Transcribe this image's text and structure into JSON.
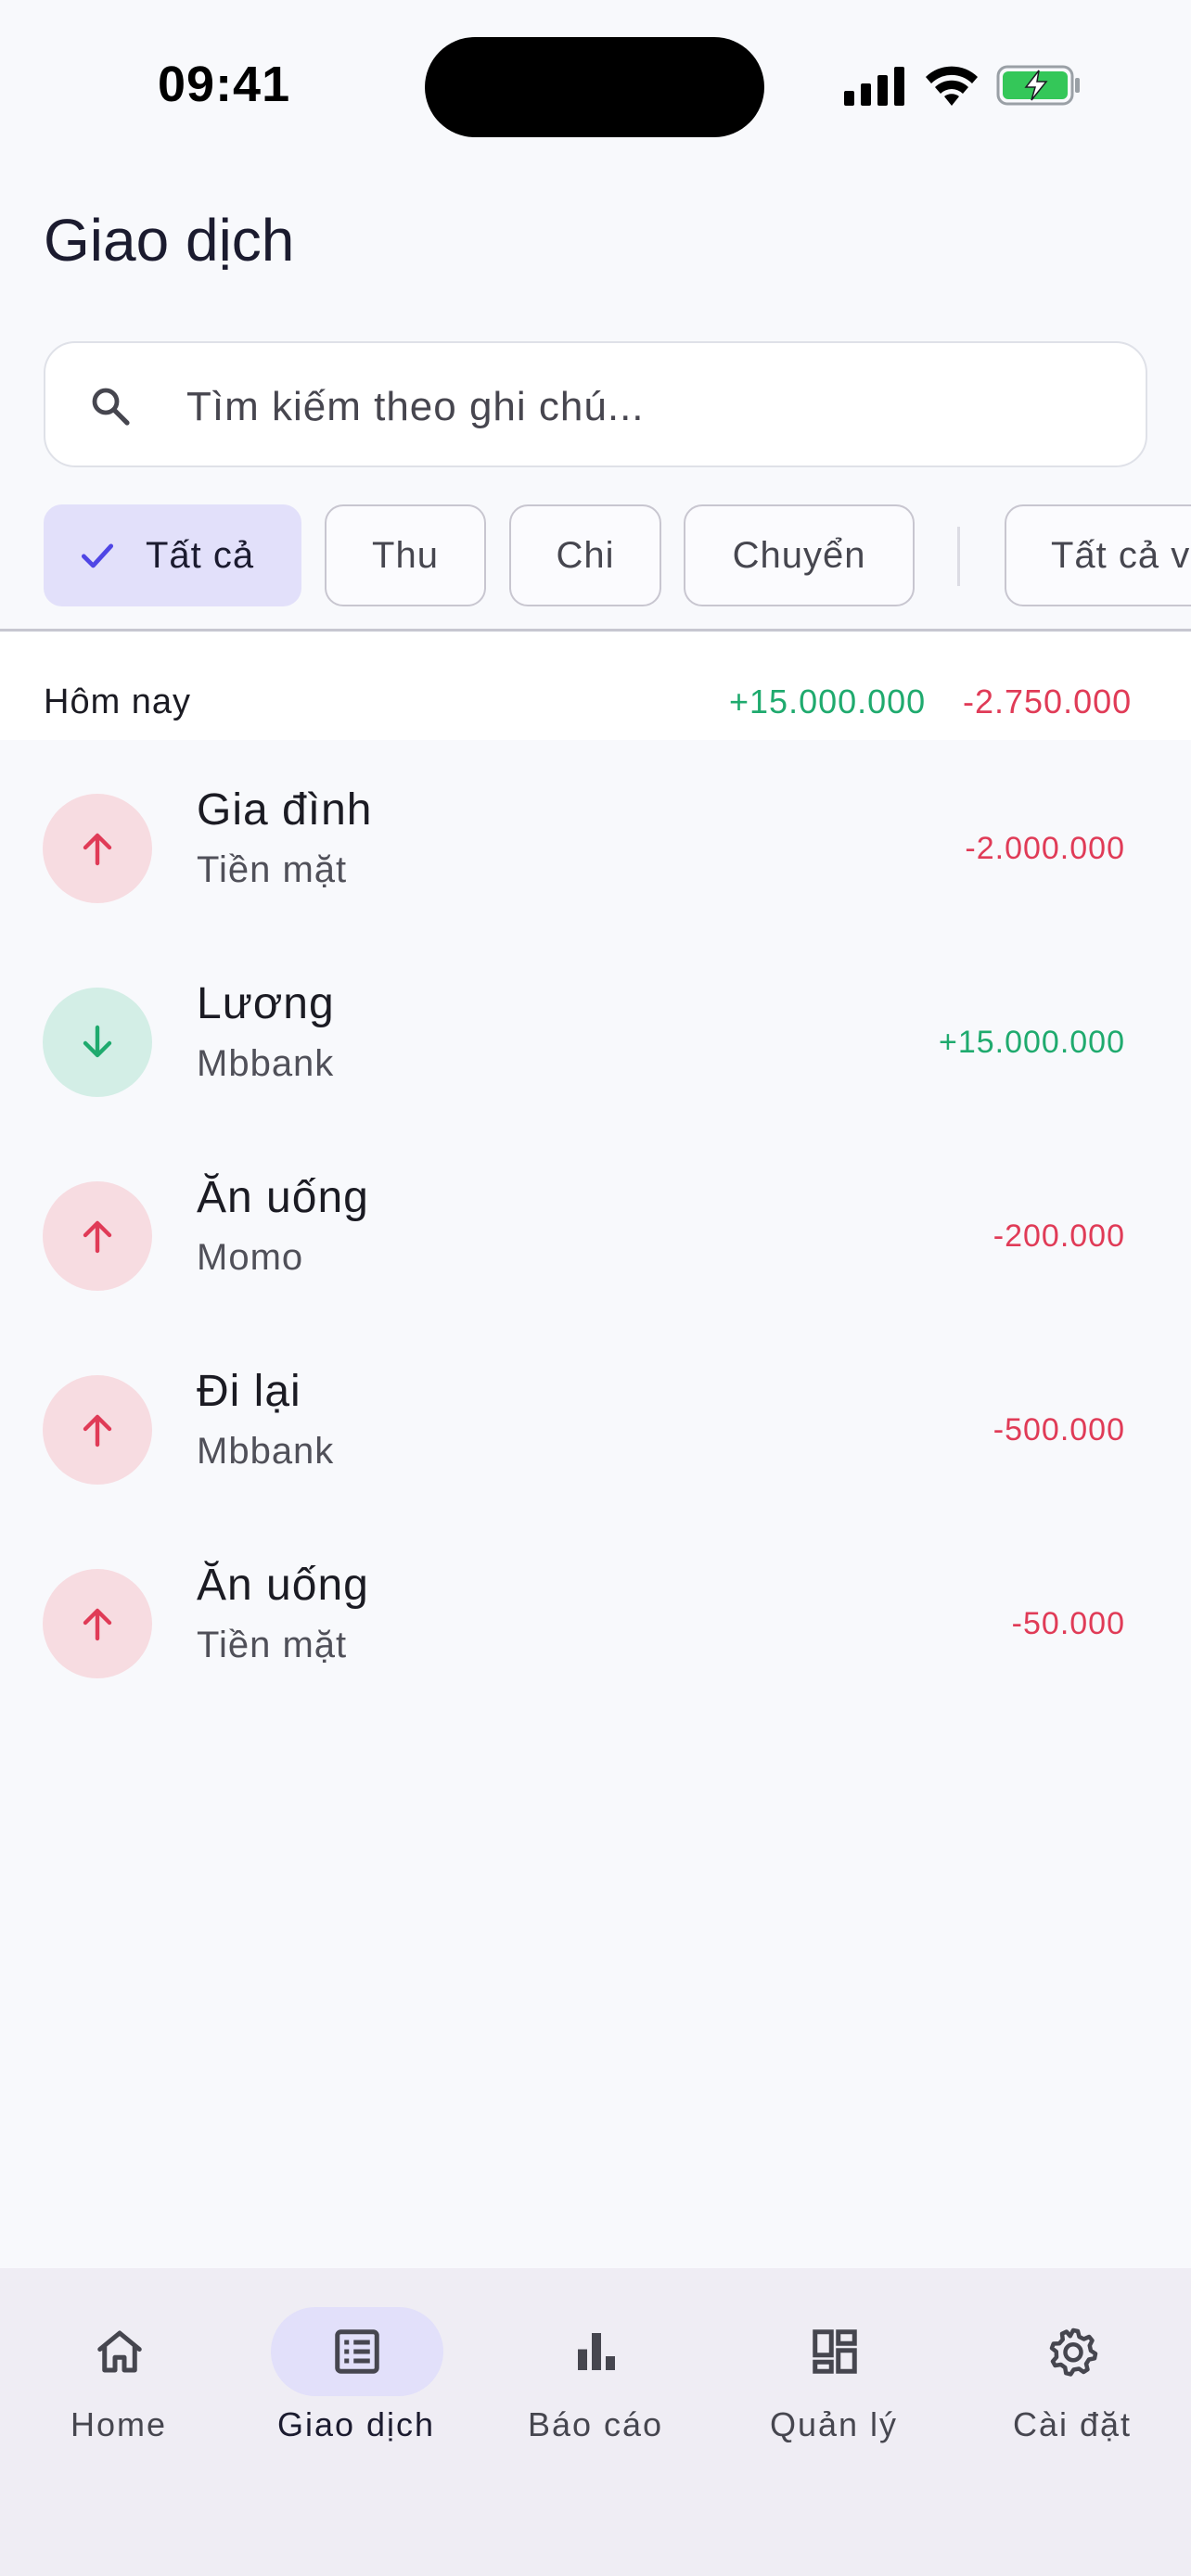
{
  "status_bar": {
    "time": "09:41"
  },
  "page_title": "Giao dịch",
  "search": {
    "placeholder": "Tìm kiếm theo ghi chú..."
  },
  "filters": {
    "chips": [
      {
        "label": "Tất cả",
        "selected": true
      },
      {
        "label": "Thu",
        "selected": false
      },
      {
        "label": "Chi",
        "selected": false
      },
      {
        "label": "Chuyển",
        "selected": false
      }
    ],
    "account_chip": "Tất cả v"
  },
  "day_groups": [
    {
      "label": "Hôm nay",
      "income": "+15.000.000",
      "expense": "-2.750.000",
      "transactions": [
        {
          "title": "Gia đình",
          "account": "Tiền mặt",
          "amount": "-2.000.000",
          "direction": "out"
        },
        {
          "title": "Lương",
          "account": "Mbbank",
          "amount": "+15.000.000",
          "direction": "in"
        },
        {
          "title": "Ăn uống",
          "account": "Momo",
          "amount": "-200.000",
          "direction": "out"
        },
        {
          "title": "Đi lại",
          "account": "Mbbank",
          "amount": "-500.000",
          "direction": "out"
        },
        {
          "title": "Ăn uống",
          "account": "Tiền mặt",
          "amount": "-50.000",
          "direction": "out"
        }
      ]
    }
  ],
  "bottom_nav": [
    {
      "label": "Home",
      "icon": "home-icon",
      "active": false
    },
    {
      "label": "Giao dịch",
      "icon": "list-icon",
      "active": true
    },
    {
      "label": "Báo cáo",
      "icon": "bar-chart-icon",
      "active": false
    },
    {
      "label": "Quản lý",
      "icon": "dashboard-icon",
      "active": false
    },
    {
      "label": "Cài đặt",
      "icon": "gear-icon",
      "active": false
    }
  ],
  "colors": {
    "income": "#1faa6e",
    "expense": "#e03b57",
    "accent_container": "#e2e0fa",
    "accent": "#4f46e5"
  }
}
